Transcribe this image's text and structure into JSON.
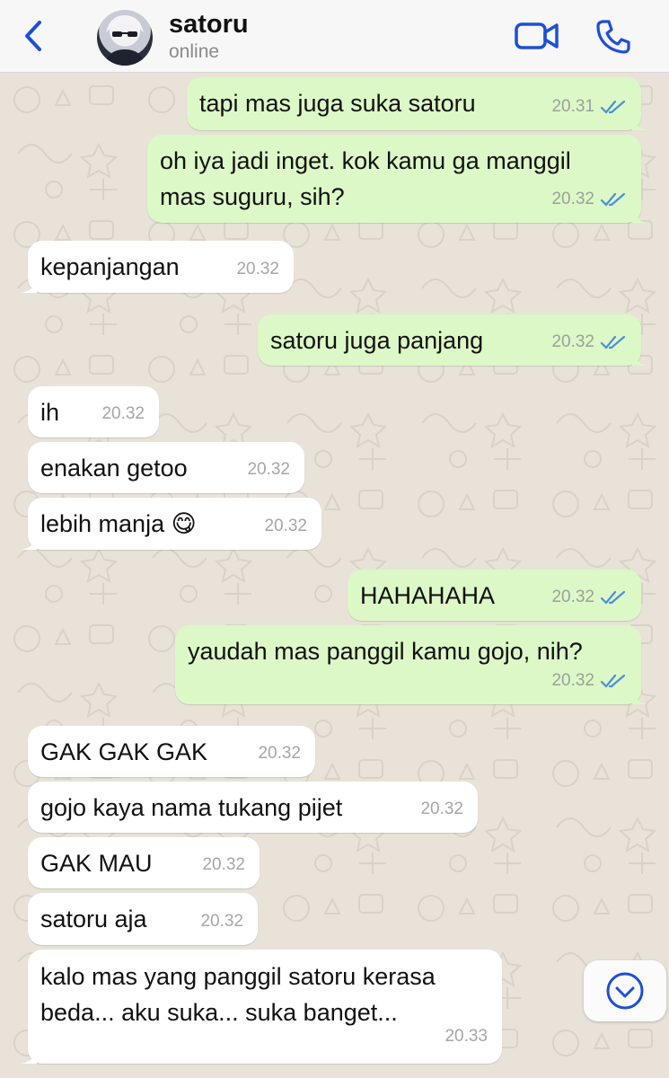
{
  "header": {
    "contact_name": "satoru",
    "status": "online",
    "icons": {
      "back": "chevron-left-icon",
      "video": "video-camera-icon",
      "call": "phone-icon"
    },
    "accent_color": "#1d4fd8"
  },
  "messages": [
    {
      "direction": "out",
      "text": "tapi mas juga suka satoru",
      "time": "20.31",
      "read": true
    },
    {
      "direction": "out",
      "text": "oh iya jadi inget. kok kamu ga manggil\nmas suguru, sih?",
      "time": "20.32",
      "read": true
    },
    {
      "direction": "in",
      "text": "kepanjangan",
      "time": "20.32"
    },
    {
      "direction": "out",
      "text": "satoru juga panjang",
      "time": "20.32",
      "read": true
    },
    {
      "direction": "in",
      "text": "ih",
      "time": "20.32"
    },
    {
      "direction": "in",
      "text": "enakan getoo",
      "time": "20.32"
    },
    {
      "direction": "in",
      "text": "lebih manja 😋",
      "time": "20.32"
    },
    {
      "direction": "out",
      "text": "HAHAHAHA",
      "time": "20.32",
      "read": true
    },
    {
      "direction": "out",
      "text": "yaudah mas panggil kamu gojo, nih?",
      "time": "20.32",
      "read": true
    },
    {
      "direction": "in",
      "text": "GAK GAK GAK",
      "time": "20.32"
    },
    {
      "direction": "in",
      "text": "gojo kaya nama tukang pijet",
      "time": "20.32"
    },
    {
      "direction": "in",
      "text": "GAK MAU",
      "time": "20.32"
    },
    {
      "direction": "in",
      "text": "satoru aja",
      "time": "20.32"
    },
    {
      "direction": "in",
      "text": "kalo mas yang panggil satoru kerasa\nbeda... aku suka... suka banget...",
      "time": "20.33"
    }
  ],
  "scroll_button": {
    "icon": "chevron-down-circle-icon"
  },
  "colors": {
    "outgoing_bubble": "#dcf8c6",
    "incoming_bubble": "#ffffff",
    "read_ticks": "#4a90d9",
    "wallpaper": "#e8e2d9"
  }
}
